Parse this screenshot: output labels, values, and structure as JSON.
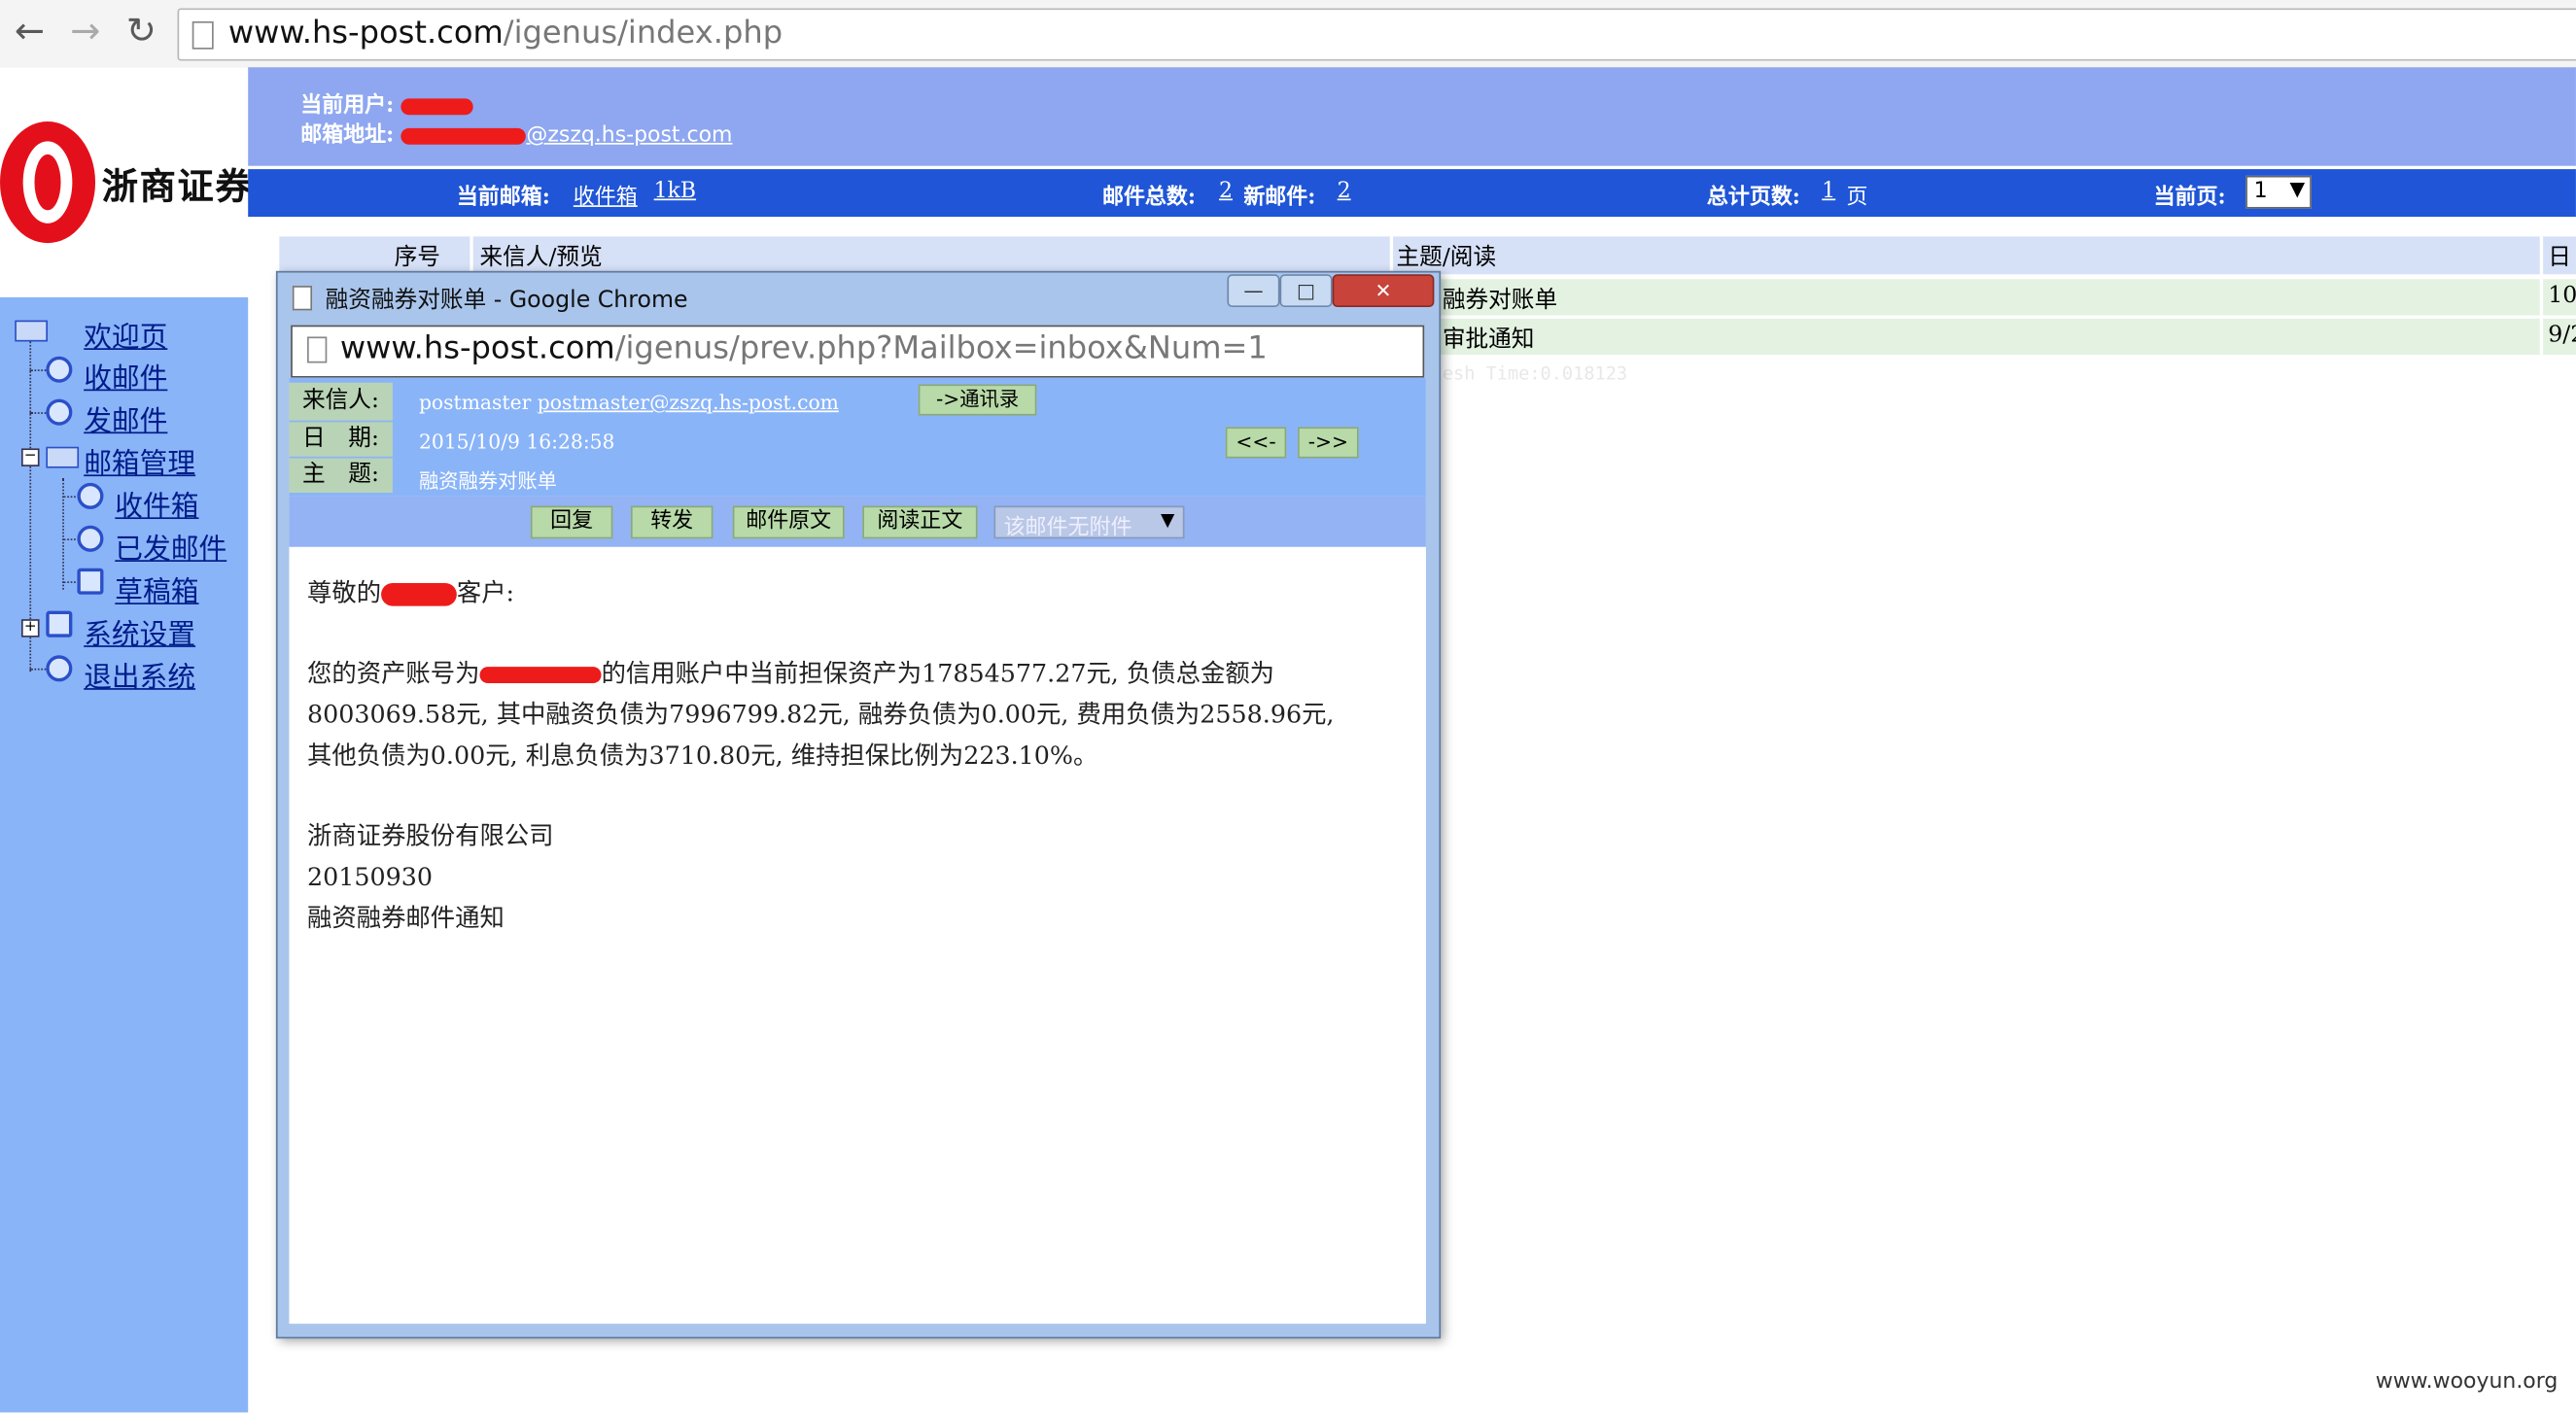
{
  "browser": {
    "url_host": "www.hs-post.com",
    "url_path": "/igenus/index.php"
  },
  "brand": {
    "logo_text": "浙商证券"
  },
  "user_header": {
    "current_user_label": "当前用户:",
    "address_label": "邮箱地址:",
    "address_visible": "@zszq.hs-post.com"
  },
  "mail_bar": {
    "current_mailbox_label": "当前邮箱:",
    "mailbox_name": "收件箱",
    "mailbox_size": "1kB",
    "total_label": "邮件总数:",
    "total_value": "2",
    "new_label": "新邮件:",
    "new_value": "2",
    "total_pages_label": "总计页数:",
    "total_pages_value": "1",
    "pages_unit": "页",
    "current_page_label": "当前页:",
    "current_page_value": "1"
  },
  "sidebar": {
    "items": [
      {
        "label": "欢迎页"
      },
      {
        "label": "收邮件"
      },
      {
        "label": "发邮件"
      },
      {
        "label": "邮箱管理"
      },
      {
        "label": "收件箱"
      },
      {
        "label": "已发邮件"
      },
      {
        "label": "草稿箱"
      },
      {
        "label": "系统设置"
      },
      {
        "label": "退出系统"
      }
    ]
  },
  "message_list": {
    "columns": [
      "序号",
      "来信人/预览",
      "主题/阅读",
      "日"
    ],
    "rows": [
      {
        "subject": "融券对账单",
        "date": "10/"
      },
      {
        "subject": "审批通知",
        "date": "9/2"
      }
    ],
    "refresh_text": "esh Time:0.018123"
  },
  "popup": {
    "window_title": "融资融券对账单 - Google Chrome",
    "url_host": "www.hs-post.com",
    "url_path": "/igenus/prev.php?Mailbox=inbox&Num=1",
    "from_label": "来信人:",
    "from_name": "postmaster",
    "from_email": "postmaster@zszq.hs-post.com",
    "address_book_button": "->通讯录",
    "date_label": "日　期:",
    "date_value": "2015/10/9 16:28:58",
    "prev_button": "<<-",
    "next_button": "->>",
    "subject_label": "主　题:",
    "subject_value": "融资融券对账单",
    "actions": {
      "reply": "回复",
      "forward": "转发",
      "source": "邮件原文",
      "read_body": "阅读正文",
      "no_attachment": "该邮件无附件"
    },
    "body": {
      "greeting_start": "尊敬的",
      "greeting_end": "客户:",
      "line1_start": "您的资产账号为",
      "line1_end": "的信用账户中当前担保资产为17854577.27元, 负债总金额为",
      "line2": "8003069.58元, 其中融资负债为7996799.82元, 融券负债为0.00元, 费用负债为2558.96元,",
      "line3": "其他负债为0.00元, 利息负债为3710.80元, 维持担保比例为223.10%。",
      "sig1": "浙商证券股份有限公司",
      "sig2": "20150930",
      "sig3": "融资融券邮件通知"
    }
  },
  "watermark": "www.wooyun.org",
  "colors": {
    "header_blue": "#8ea7f0",
    "bar_blue": "#1f55d6",
    "sidebar_blue": "#8ab4f8",
    "brand_red": "#e3101b",
    "redaction": "#ee1b1b"
  }
}
